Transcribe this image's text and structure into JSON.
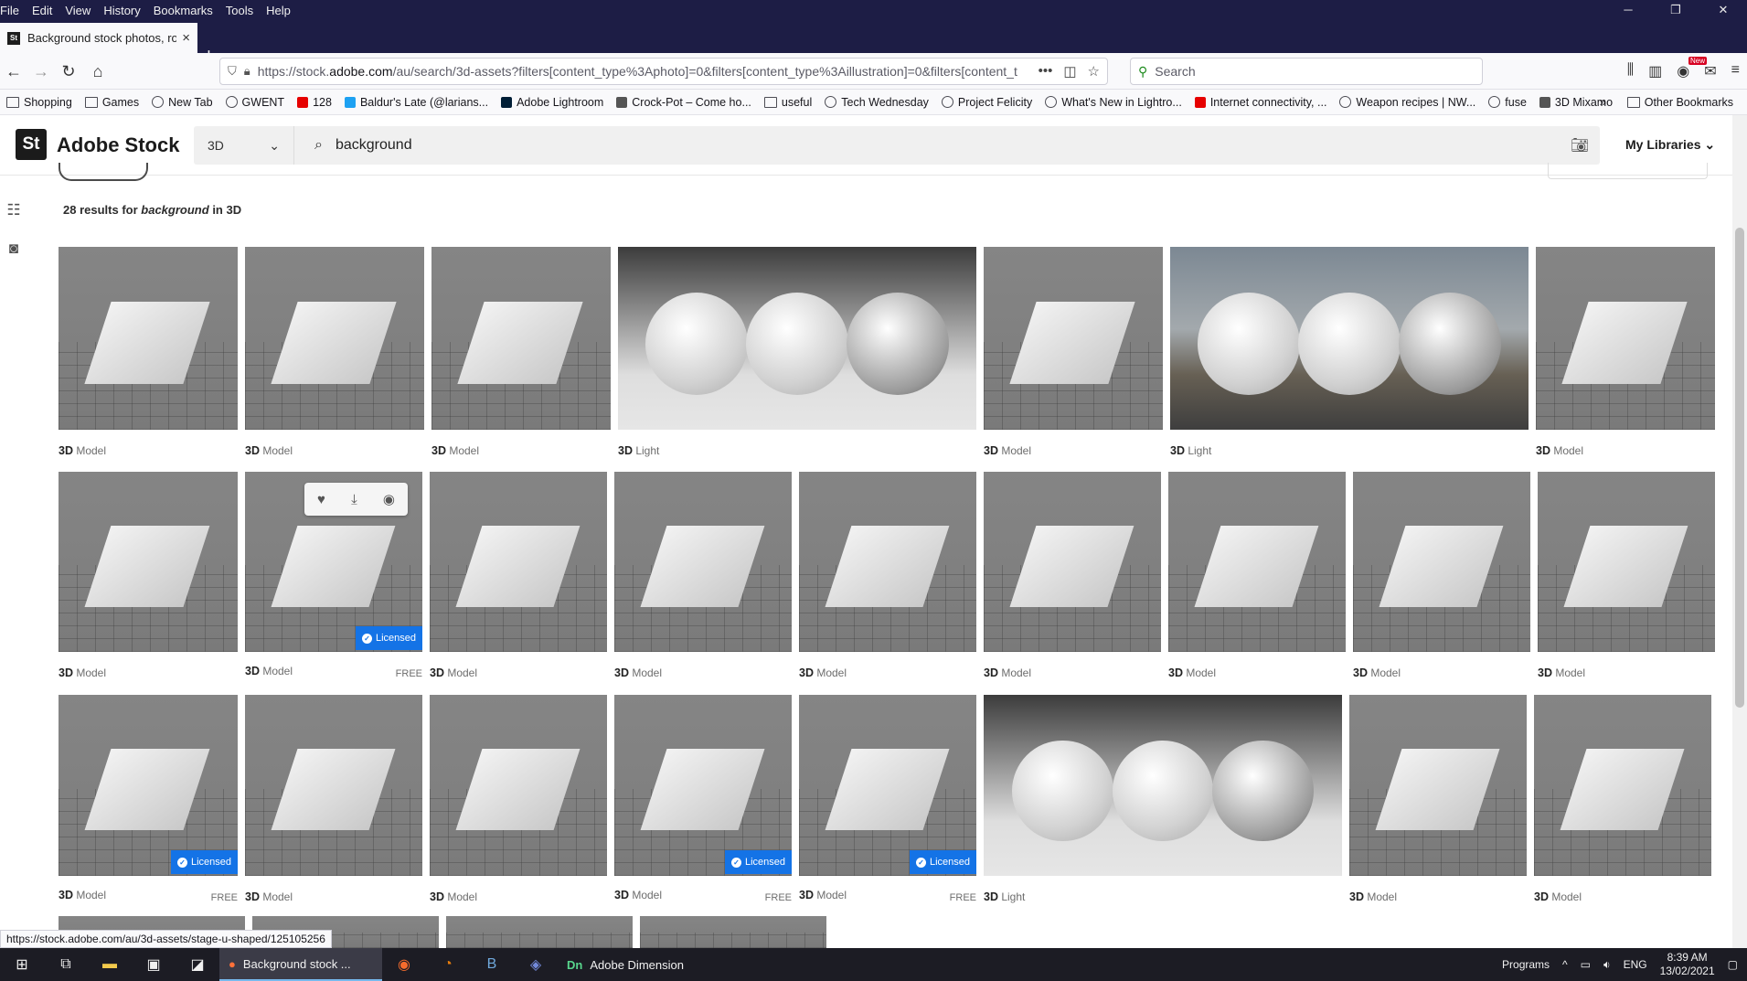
{
  "browser": {
    "menu": [
      "File",
      "Edit",
      "View",
      "History",
      "Bookmarks",
      "Tools",
      "Help"
    ],
    "tab_title": "Background stock photos, roya",
    "tab_favicon": "St",
    "url_host": "https://stock.",
    "url_domain": "adobe.com",
    "url_path": "/au/search/3d-assets?filters[content_type%3Aphoto]=0&filters[content_type%3Aillustration]=0&filters[content_t",
    "search_placeholder": "Search",
    "new_badge": "New",
    "bookmarks": [
      {
        "label": "Shopping",
        "kind": "folder"
      },
      {
        "label": "Games",
        "kind": "folder"
      },
      {
        "label": "New Tab",
        "kind": "globe"
      },
      {
        "label": "GWENT",
        "kind": "globe"
      },
      {
        "label": "128",
        "kind": "adobe"
      },
      {
        "label": "Baldur's Late (@larians...",
        "kind": "twitter"
      },
      {
        "label": "Adobe Lightroom",
        "kind": "lr"
      },
      {
        "label": "Crock-Pot – Come ho...",
        "kind": "other"
      },
      {
        "label": "useful",
        "kind": "folder"
      },
      {
        "label": "Tech Wednesday",
        "kind": "globe"
      },
      {
        "label": "Project Felicity",
        "kind": "globe"
      },
      {
        "label": "What's New in Lightro...",
        "kind": "globe"
      },
      {
        "label": "Internet connectivity, ...",
        "kind": "adobe"
      },
      {
        "label": "Weapon recipes | NW...",
        "kind": "globe"
      },
      {
        "label": "fuse",
        "kind": "globe"
      },
      {
        "label": "3D Mixamo",
        "kind": "other"
      }
    ],
    "other_bookmarks": "Other Bookmarks"
  },
  "stock": {
    "logo": "St",
    "brand": "Adobe Stock",
    "category": "3D",
    "query": "background",
    "my_libraries": "My Libraries",
    "results_count": "28 results for",
    "results_query": "background",
    "results_scope": "in 3D"
  },
  "items": [
    {
      "kind": "Model",
      "thumb": "gray",
      "row": 0
    },
    {
      "kind": "Model",
      "thumb": "gray",
      "row": 0
    },
    {
      "kind": "Model",
      "thumb": "gray",
      "row": 0
    },
    {
      "kind": "Light",
      "thumb": "light",
      "row": 0
    },
    {
      "kind": "Model",
      "thumb": "gray",
      "row": 0
    },
    {
      "kind": "Light",
      "thumb": "hdri",
      "row": 0
    },
    {
      "kind": "Model",
      "thumb": "gray",
      "row": 0
    },
    {
      "kind": "Model",
      "thumb": "gray",
      "row": 1
    },
    {
      "kind": "Model",
      "thumb": "gray",
      "row": 1,
      "licensed": true,
      "free": true,
      "hover": true
    },
    {
      "kind": "Model",
      "thumb": "gray",
      "row": 1
    },
    {
      "kind": "Model",
      "thumb": "gray",
      "row": 1
    },
    {
      "kind": "Model",
      "thumb": "gray",
      "row": 1
    },
    {
      "kind": "Model",
      "thumb": "gray",
      "row": 1
    },
    {
      "kind": "Model",
      "thumb": "gray",
      "row": 1
    },
    {
      "kind": "Model",
      "thumb": "gray",
      "row": 1
    },
    {
      "kind": "Model",
      "thumb": "gray",
      "row": 1
    },
    {
      "kind": "Model",
      "thumb": "gray",
      "row": 2,
      "licensed": true,
      "free": true
    },
    {
      "kind": "Model",
      "thumb": "gray",
      "row": 2
    },
    {
      "kind": "Model",
      "thumb": "gray",
      "row": 2
    },
    {
      "kind": "Model",
      "thumb": "gray",
      "row": 2,
      "licensed": true,
      "free": true
    },
    {
      "kind": "Model",
      "thumb": "gray",
      "row": 2,
      "licensed": true,
      "free": true
    },
    {
      "kind": "Light",
      "thumb": "light",
      "row": 2
    },
    {
      "kind": "Model",
      "thumb": "gray",
      "row": 2
    },
    {
      "kind": "Model",
      "thumb": "gray",
      "row": 2
    }
  ],
  "labels": {
    "three_d": "3D",
    "licensed": "Licensed",
    "free": "FREE"
  },
  "status_link": "https://stock.adobe.com/au/3d-assets/stage-u-shaped/125105256",
  "taskbar": {
    "active_app": "Background stock ...",
    "dimension_app": "Adobe Dimension",
    "programs": "Programs",
    "lang": "ENG",
    "time": "8:39 AM",
    "date": "13/02/2021"
  },
  "colors": {
    "accent": "#1473e6",
    "titlebar": "#1d1d45"
  }
}
